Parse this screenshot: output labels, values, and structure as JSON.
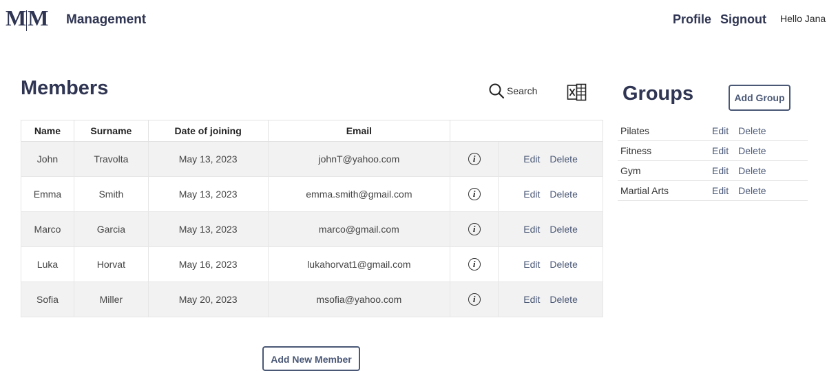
{
  "header": {
    "logo": "M|M",
    "logo_left": "M",
    "logo_right": "M",
    "brand": "Management",
    "profile_label": "Profile",
    "signout_label": "Signout",
    "greeting": "Hello Jana"
  },
  "members": {
    "title": "Members",
    "search_label": "Search",
    "columns": [
      "Name",
      "Surname",
      "Date of joining",
      "Email",
      ""
    ],
    "rows": [
      {
        "name": "John",
        "surname": "Travolta",
        "date": "May 13, 2023",
        "email": "johnT@yahoo.com",
        "edit": "Edit",
        "delete": "Delete"
      },
      {
        "name": "Emma",
        "surname": "Smith",
        "date": "May 13, 2023",
        "email": "emma.smith@gmail.com",
        "edit": "Edit",
        "delete": "Delete"
      },
      {
        "name": "Marco",
        "surname": "Garcia",
        "date": "May 13, 2023",
        "email": "marco@gmail.com",
        "edit": "Edit",
        "delete": "Delete"
      },
      {
        "name": "Luka",
        "surname": "Horvat",
        "date": "May 16, 2023",
        "email": "lukahorvat1@gmail.com",
        "edit": "Edit",
        "delete": "Delete"
      },
      {
        "name": "Sofia",
        "surname": "Miller",
        "date": "May 20, 2023",
        "email": "msofia@yahoo.com",
        "edit": "Edit",
        "delete": "Delete"
      }
    ],
    "add_button": "Add New Member"
  },
  "groups": {
    "title": "Groups",
    "add_button": "Add Group",
    "items": [
      {
        "name": "Pilates",
        "edit": "Edit",
        "delete": "Delete"
      },
      {
        "name": "Fitness",
        "edit": "Edit",
        "delete": "Delete"
      },
      {
        "name": "Gym",
        "edit": "Edit",
        "delete": "Delete"
      },
      {
        "name": "Martial Arts",
        "edit": "Edit",
        "delete": "Delete"
      }
    ]
  },
  "colors": {
    "brand": "#2f3552",
    "accent": "#4a5876",
    "row_stripe": "#f2f2f2"
  },
  "icons": {
    "search": "search-icon",
    "excel": "excel-export-icon",
    "info": "info-icon"
  }
}
